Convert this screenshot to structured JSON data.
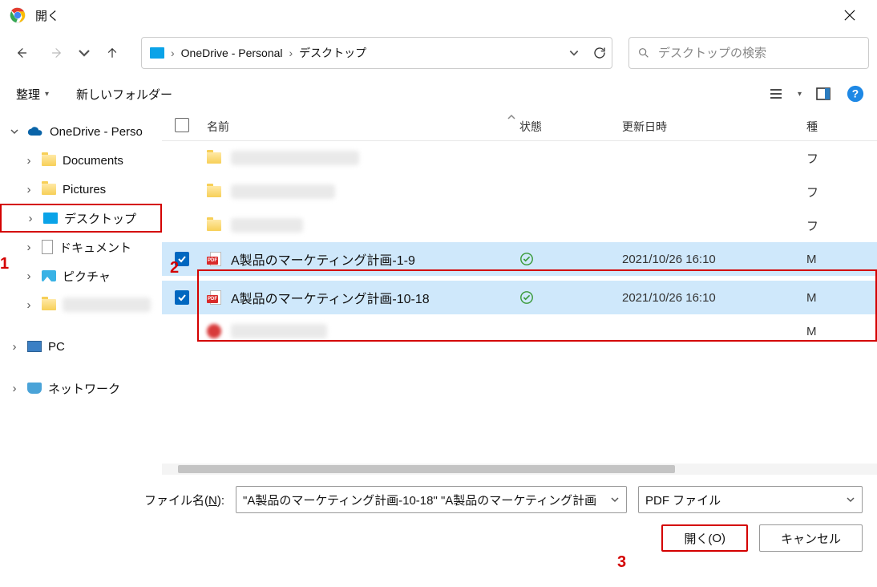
{
  "window": {
    "title": "開く"
  },
  "breadcrumbs": {
    "root_label": "",
    "parts": [
      "OneDrive - Personal",
      "デスクトップ"
    ]
  },
  "search": {
    "placeholder": "デスクトップの検索"
  },
  "toolbar": {
    "organize": "整理",
    "new_folder": "新しいフォルダー"
  },
  "columns": {
    "name": "名前",
    "state": "状態",
    "modified": "更新日時",
    "type": "種"
  },
  "sidebar": {
    "items": [
      {
        "label": "OneDrive - Perso",
        "kind": "cloud",
        "depth": 0,
        "expanded": true
      },
      {
        "label": "Documents",
        "kind": "folder",
        "depth": 1
      },
      {
        "label": "Pictures",
        "kind": "folder",
        "depth": 1
      },
      {
        "label": "デスクトップ",
        "kind": "desktop",
        "depth": 1,
        "selected": true
      },
      {
        "label": "ドキュメント",
        "kind": "doc",
        "depth": 1
      },
      {
        "label": "ピクチャ",
        "kind": "pic",
        "depth": 1
      },
      {
        "label": "",
        "kind": "folder",
        "depth": 1,
        "blurred": true
      },
      {
        "label": "PC",
        "kind": "pc",
        "depth": 0,
        "gap": true
      },
      {
        "label": "ネットワーク",
        "kind": "net",
        "depth": 0,
        "gap": true
      }
    ]
  },
  "files": [
    {
      "blurred": true,
      "type_text": "フ",
      "icon": "folder"
    },
    {
      "blurred": true,
      "type_text": "フ",
      "icon": "folder"
    },
    {
      "blurred": true,
      "type_text": "フ",
      "icon": "folder"
    },
    {
      "name": "A製品のマーケティング計画-1-9",
      "modified": "2021/10/26 16:10",
      "type_text": "M",
      "icon": "pdf",
      "selected": true,
      "checked": true,
      "status": "synced"
    },
    {
      "name": "A製品のマーケティング計画-10-18",
      "modified": "2021/10/26 16:10",
      "type_text": "M",
      "icon": "pdf",
      "selected": true,
      "checked": true,
      "status": "synced"
    },
    {
      "blurred": true,
      "type_text": "M",
      "icon": "red"
    }
  ],
  "filename": {
    "label_pre": "ファイル名(",
    "label_accel": "N",
    "label_post": "):",
    "value": "\"A製品のマーケティング計画-10-18\" \"A製品のマーケティング計画",
    "filter": "PDF ファイル"
  },
  "buttons": {
    "open_pre": "開く(",
    "open_accel": "O",
    "open_post": ")",
    "cancel": "キャンセル"
  },
  "markers": {
    "m1": "1",
    "m2": "2",
    "m3": "3"
  }
}
